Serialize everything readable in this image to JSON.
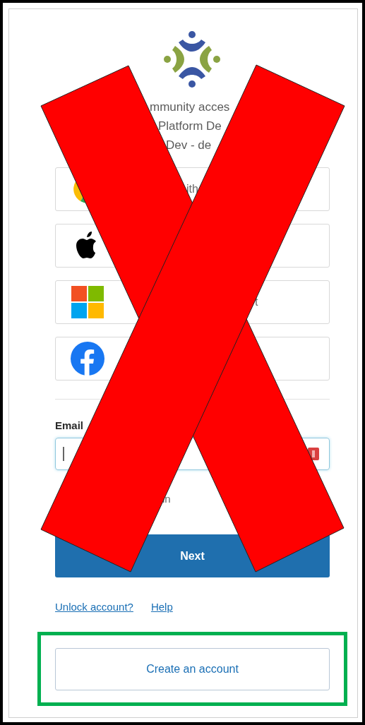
{
  "heading_lines": [
    "mmunity acces",
    "Platform De",
    "Dev - de"
  ],
  "social_buttons": [
    {
      "kind": "google",
      "label": "ith"
    },
    {
      "kind": "apple"
    },
    {
      "kind": "microsoft",
      "label": "t"
    },
    {
      "kind": "facebook"
    }
  ],
  "email": {
    "label": "Email"
  },
  "remember": {
    "label": "in"
  },
  "next_button": "Next",
  "links": [
    "Unlock account?",
    "Help"
  ],
  "create_account_button": "Create an account"
}
